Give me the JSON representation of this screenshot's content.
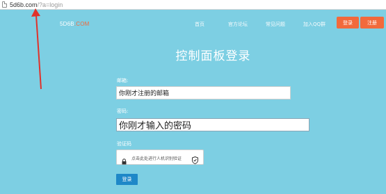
{
  "browser": {
    "url_host": "5d6b.com",
    "url_path": "/?a=login"
  },
  "navbar": {
    "logo_part1": "5D6B",
    "logo_part2": ".COM",
    "links": [
      "首页",
      "官方论坛",
      "常见问题",
      "加入QQ群"
    ],
    "login_button": "登录",
    "register_button": "注册"
  },
  "form": {
    "title": "控制面板登录",
    "email_label": "邮箱:",
    "email_value": "你刚才注册的邮箱",
    "password_label": "密码:",
    "password_value": "你刚才输入的密码",
    "captcha_label": "验证码",
    "captcha_prompt": "点击此处进行人机识别验证",
    "submit_label": "登录"
  },
  "colors": {
    "background": "#7dcfe3",
    "accent_orange": "#f26a3c",
    "submit_blue": "#1e88c8"
  }
}
